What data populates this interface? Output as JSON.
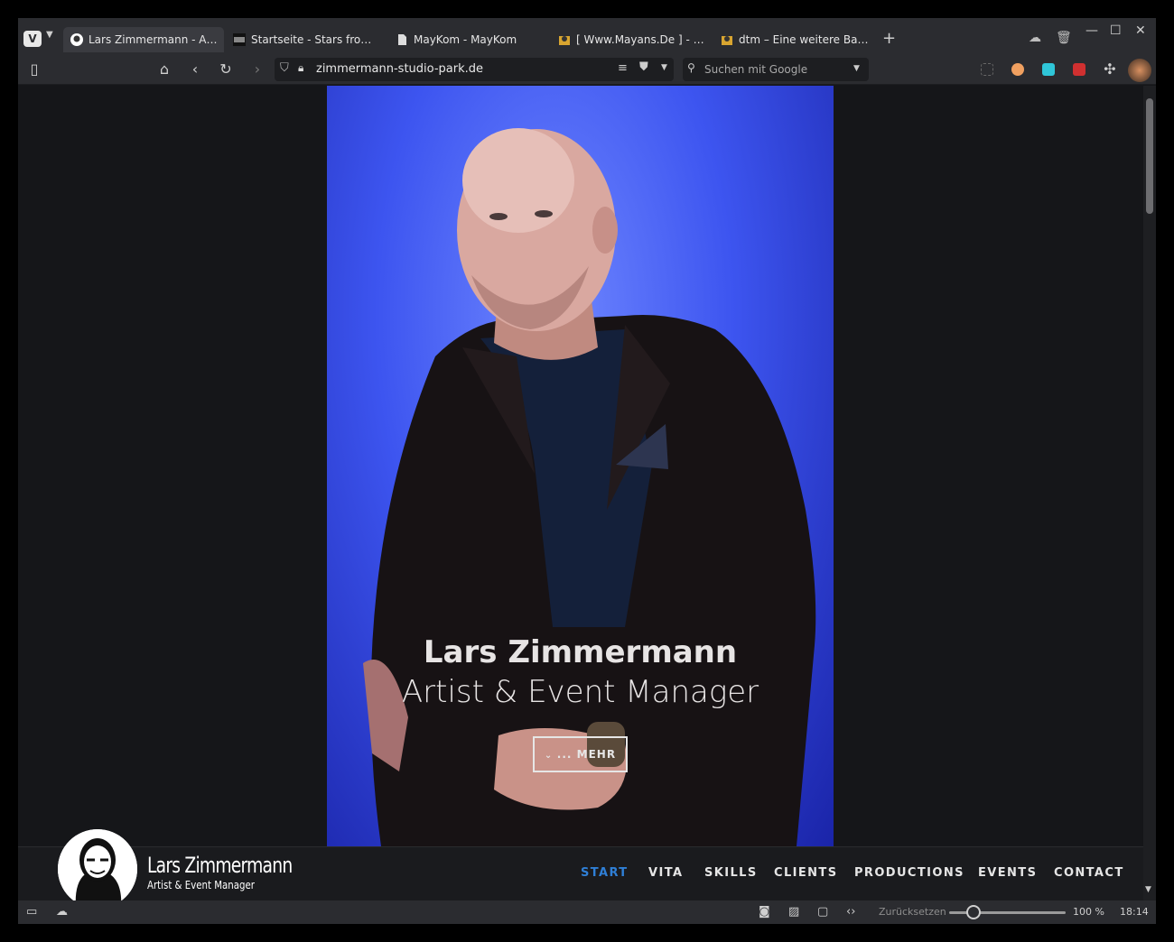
{
  "tabs": [
    {
      "label": "Lars Zimmermann - Artist &",
      "active": true
    },
    {
      "label": "Startseite - Stars from th...",
      "active": false
    },
    {
      "label": "MayKom - MayKom",
      "active": false
    },
    {
      "label": "[ Www.Mayans.De ] - Ma...",
      "active": false
    },
    {
      "label": "dtm – Eine weitere Baust...",
      "active": false
    }
  ],
  "address": {
    "url": "zimmermann-studio-park.de"
  },
  "search": {
    "placeholder": "Suchen mit Google"
  },
  "hero": {
    "title": "Lars Zimmermann",
    "subtitle": "Artist & Event Manager",
    "more_button": "... MEHR"
  },
  "logo": {
    "name": "Lars Zimmermann",
    "tagline": "Artist & Event Manager"
  },
  "menu": [
    "START",
    "VITA",
    "SKILLS",
    "CLIENTS",
    "PRODUCTIONS",
    "EVENTS",
    "CONTACT"
  ],
  "statusbar": {
    "reset_label": "Zurücksetzen",
    "zoom": "100 %",
    "time": "18:14"
  },
  "colors": {
    "accent": "#2f7fd6",
    "hero_blue": "#3d55f0"
  }
}
